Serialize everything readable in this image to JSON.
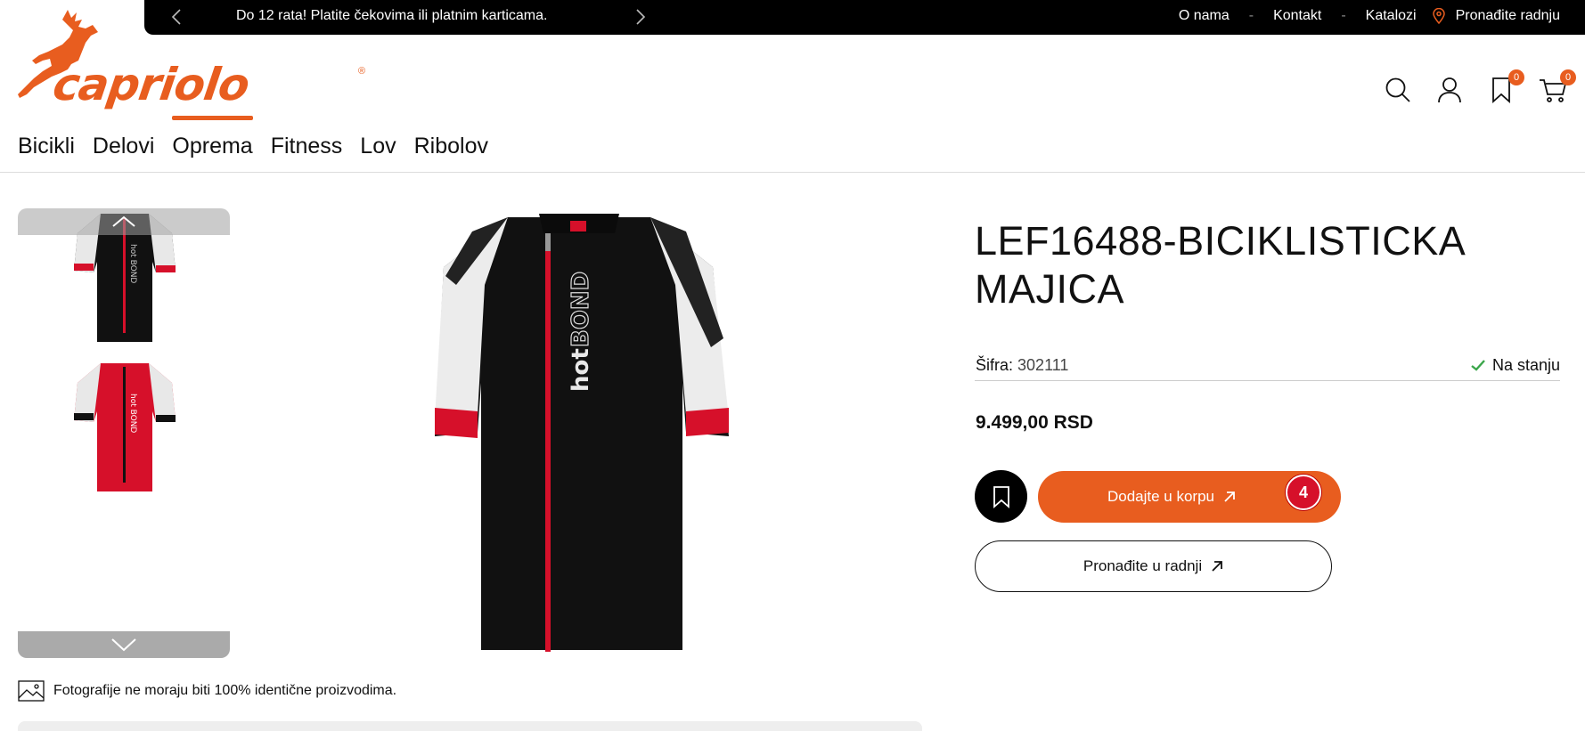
{
  "topbar": {
    "promo": "Do 12 rata! Platite čekovima ili platnim karticama.",
    "links": [
      "O nama",
      "Kontakt",
      "Katalozi"
    ],
    "store_link": "Pronađite radnju"
  },
  "logo": {
    "text": "capriolo",
    "mark": "®"
  },
  "header": {
    "wishlist_count": "0",
    "cart_count": "0"
  },
  "nav": [
    "Bicikli",
    "Delovi",
    "Oprema",
    "Fitness",
    "Lov",
    "Ribolov"
  ],
  "nav_active": "Oprema",
  "product": {
    "title_line1": "LEF16488-BICIKLISTICKA",
    "title_line2": "MAJICA",
    "sku_label": "Šifra:",
    "sku": "302111",
    "stock": "Na stanju",
    "price": "9.499,00 RSD",
    "add_to_cart": "Dodajte u korpu",
    "quantity_badge": "4",
    "find_in_store": "Pronađite u radnji"
  },
  "gallery": {
    "disclaimer": "Fotografije ne moraju biti 100% identične proizvodima.",
    "jersey_text_hot": "hot",
    "jersey_text_bond": "BOND"
  },
  "colors": {
    "accent": "#e85d1f",
    "badge_red": "#d6102a",
    "stock_green": "#3aa64a"
  }
}
